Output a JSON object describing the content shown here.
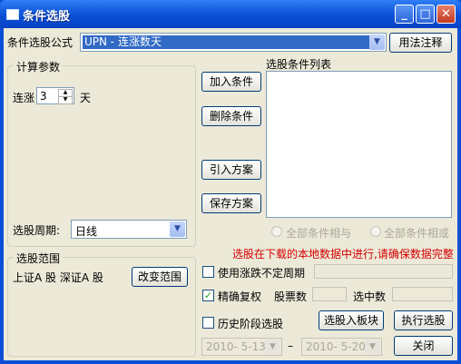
{
  "window": {
    "title": "条件选股"
  },
  "formula": {
    "label": "条件选股公式",
    "value": "UPN     - 连涨数天",
    "help_button": "用法注释"
  },
  "params": {
    "legend": "计算参数",
    "label": "连涨",
    "value": "3",
    "unit": "天",
    "period_label": "选股周期:",
    "period_value": "日线"
  },
  "condition_list": {
    "label": "选股条件列表"
  },
  "buttons": {
    "add": "加入条件",
    "delete": "删除条件",
    "import": "引入方案",
    "save": "保存方案",
    "select_to_block": "选股入板块",
    "execute": "执行选股",
    "close": "关闭"
  },
  "logic": {
    "and": "全部条件相与",
    "or": "全部条件相或"
  },
  "warning": "选股在下载的本地数据中进行,请确保数据完整",
  "scope": {
    "legend": "选股范围",
    "text": "上证A 股 深证A 股",
    "change_button": "改变范围"
  },
  "options": {
    "period_check": "使用涨跌不定周期",
    "restore_check": "精确复权",
    "stock_count_label": "股票数",
    "selected_count_label": "选中数",
    "history_check": "历史阶段选股"
  },
  "dates": {
    "start": "2010- 5-13",
    "separator": "–",
    "end": "2010- 5-20"
  },
  "colors": {
    "titlebar": "#0a4fd6",
    "face": "#ece9d8",
    "warning": "#d40000"
  }
}
